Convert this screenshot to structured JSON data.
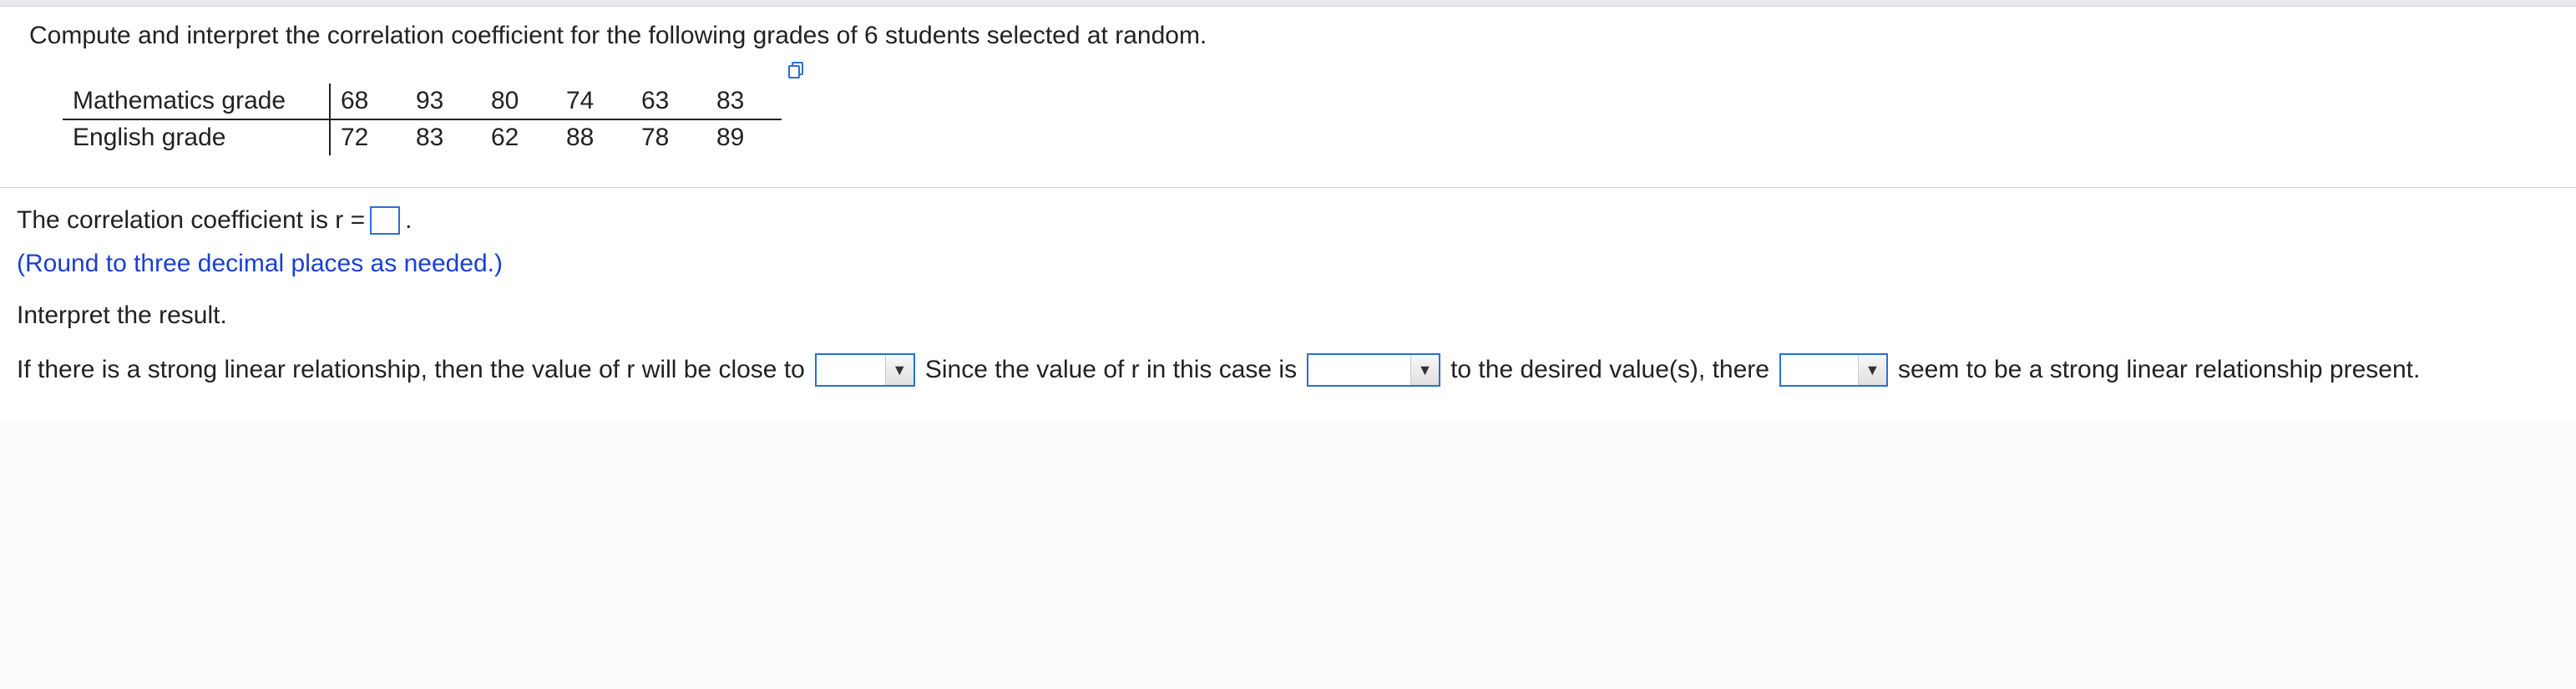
{
  "prompt": "Compute and interpret the correlation coefficient for the following grades of 6 students selected at random.",
  "table": {
    "rows": [
      {
        "label": "Mathematics grade",
        "values": [
          "68",
          "93",
          "80",
          "74",
          "63",
          "83"
        ]
      },
      {
        "label": "English grade",
        "values": [
          "72",
          "83",
          "62",
          "88",
          "78",
          "89"
        ]
      }
    ]
  },
  "answer": {
    "line1_prefix": "The correlation coefficient is r =",
    "line1_suffix": ".",
    "hint": "(Round to three decimal places as needed.)",
    "interpret_label": "Interpret the result.",
    "sentence": {
      "p1": "If there is a strong linear relationship, then the value of r will be close to",
      "p2": "Since the value of r in this case is",
      "p3": "to the desired value(s), there",
      "p4": "seem to be a strong linear relationship present."
    }
  }
}
